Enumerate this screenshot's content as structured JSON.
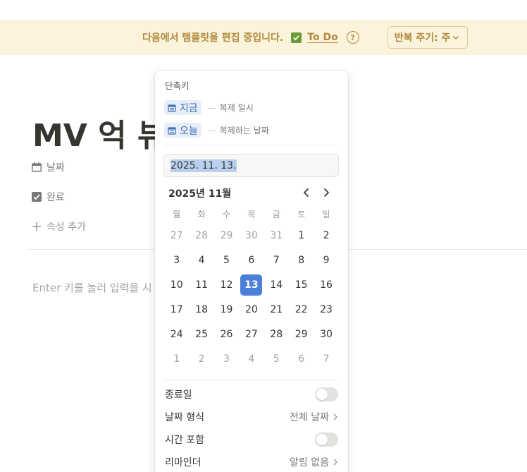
{
  "banner": {
    "text": "다음에서 템플릿을 편집 중입니다.",
    "todo_label": "To Do",
    "help_icon": "?",
    "repeat_label": "반복 주기: 주",
    "bg_color": "#fbf3db",
    "text_color": "#b08a3e"
  },
  "page": {
    "title": "MV 억 뷰",
    "properties": [
      {
        "icon": "calendar-icon",
        "label": "날짜"
      },
      {
        "icon": "checkbox-icon",
        "label": "완료"
      }
    ],
    "add_property": "속성 추가",
    "placeholder": "Enter 키를 눌러 입력을 시"
  },
  "date_popup": {
    "shortcuts_heading": "단축키",
    "shortcuts": [
      {
        "chip": "지금",
        "desc": "복제 일시"
      },
      {
        "chip": "오늘",
        "desc": "복제하는 날짜"
      }
    ],
    "date_input": "2025. 11. 13.",
    "month_label": "2025년 11월",
    "weekdays": [
      "월",
      "화",
      "수",
      "목",
      "금",
      "토",
      "일"
    ],
    "weeks": [
      [
        {
          "d": "27",
          "m": true
        },
        {
          "d": "28",
          "m": true
        },
        {
          "d": "29",
          "m": true
        },
        {
          "d": "30",
          "m": true
        },
        {
          "d": "31",
          "m": true
        },
        {
          "d": "1"
        },
        {
          "d": "2"
        }
      ],
      [
        {
          "d": "3"
        },
        {
          "d": "4"
        },
        {
          "d": "5"
        },
        {
          "d": "6"
        },
        {
          "d": "7"
        },
        {
          "d": "8"
        },
        {
          "d": "9"
        }
      ],
      [
        {
          "d": "10"
        },
        {
          "d": "11"
        },
        {
          "d": "12"
        },
        {
          "d": "13",
          "sel": true
        },
        {
          "d": "14"
        },
        {
          "d": "15"
        },
        {
          "d": "16"
        }
      ],
      [
        {
          "d": "17"
        },
        {
          "d": "18"
        },
        {
          "d": "19"
        },
        {
          "d": "20"
        },
        {
          "d": "21"
        },
        {
          "d": "22"
        },
        {
          "d": "23"
        }
      ],
      [
        {
          "d": "24"
        },
        {
          "d": "25"
        },
        {
          "d": "26"
        },
        {
          "d": "27"
        },
        {
          "d": "28"
        },
        {
          "d": "29"
        },
        {
          "d": "30"
        }
      ],
      [
        {
          "d": "1",
          "m": true
        },
        {
          "d": "2",
          "m": true
        },
        {
          "d": "3",
          "m": true
        },
        {
          "d": "4",
          "m": true
        },
        {
          "d": "5",
          "m": true
        },
        {
          "d": "6",
          "m": true
        },
        {
          "d": "7",
          "m": true
        }
      ]
    ],
    "selected_color": "#4a80d8",
    "options": {
      "end_date": "종료일",
      "date_format": "날짜 형식",
      "date_format_value": "전체 날짜",
      "include_time": "시간 포함",
      "reminder": "리마인더",
      "reminder_value": "알림 없음"
    }
  }
}
